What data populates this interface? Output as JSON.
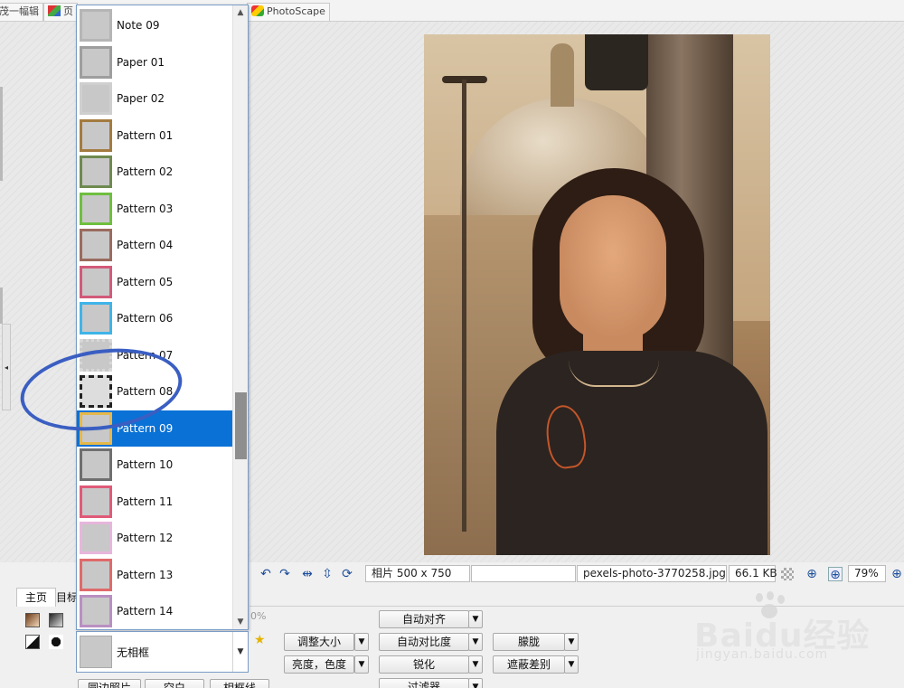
{
  "top_tabs": [
    {
      "label": "茂一幅辑"
    },
    {
      "label": "页"
    },
    {
      "label": "PhotoScape"
    }
  ],
  "frames_dropdown": {
    "items": [
      {
        "label": "Note 09",
        "border_color": "#b5b5b5"
      },
      {
        "label": "Paper 01",
        "border_color": "#9e9e9e"
      },
      {
        "label": "Paper 02",
        "border_color": "#cfcfcf"
      },
      {
        "label": "Pattern 01",
        "border_color": "#a47b3f"
      },
      {
        "label": "Pattern 02",
        "border_color": "#6f8a4f"
      },
      {
        "label": "Pattern 03",
        "border_color": "#6fbf3f"
      },
      {
        "label": "Pattern 04",
        "border_color": "#9b6b5e"
      },
      {
        "label": "Pattern 05",
        "border_color": "#d25a7a"
      },
      {
        "label": "Pattern 06",
        "border_color": "#3fb4e8"
      },
      {
        "label": "Pattern 07",
        "border_color": "#d8d8d8"
      },
      {
        "label": "Pattern 08",
        "border_color": "#222222"
      },
      {
        "label": "Pattern 09",
        "border_color": "#e6b84a",
        "selected": true
      },
      {
        "label": "Pattern 10",
        "border_color": "#6f6f6f"
      },
      {
        "label": "Pattern 11",
        "border_color": "#e05a78"
      },
      {
        "label": "Pattern 12",
        "border_color": "#e7b6dc"
      },
      {
        "label": "Pattern 13",
        "border_color": "#e06a6a"
      },
      {
        "label": "Pattern 14",
        "border_color": "#b98fc2"
      }
    ],
    "selected_value": "无相框"
  },
  "status": {
    "photo_size": "相片 500 x 750",
    "filename": "pexels-photo-3770258.jpg",
    "filesize": "66.1 KB",
    "zoom": "79%"
  },
  "main_tabs": {
    "home": "主页",
    "second": "目标"
  },
  "partial_percent": "0%",
  "tools": {
    "auto_level": "自动对齐",
    "resize": "调整大小",
    "auto_contrast": "自动对比度",
    "bright_color": "亮度，色度",
    "sharpen": "锐化",
    "filter": "过滤器",
    "blur": "朦胧",
    "backlight": "遮蔽差别"
  },
  "bottom_buttons": [
    "圆边照片",
    "空白",
    "相框线"
  ],
  "watermark": {
    "logo": "Baidu经验",
    "url": "jingyan.baidu.com"
  },
  "colors": {
    "selection": "#0a72d6",
    "annotation_circle": "#3a5ec2"
  }
}
